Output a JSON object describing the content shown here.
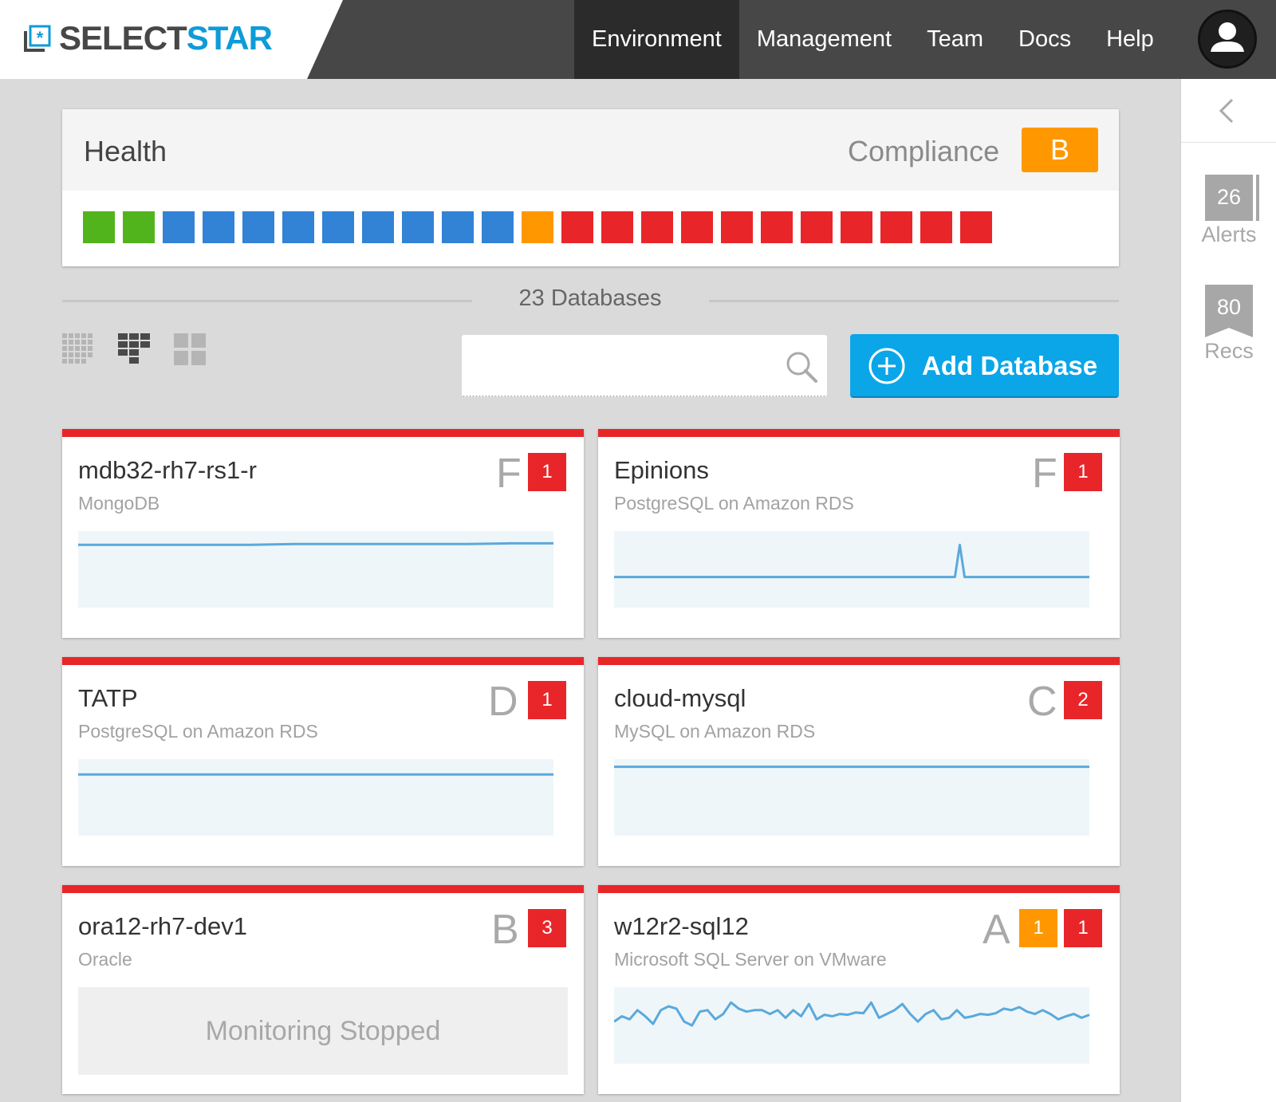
{
  "brand": {
    "word_1": "SELECT",
    "word_2": "STAR",
    "color_dark": "#474747",
    "color_accent": "#0e9bd8"
  },
  "nav": {
    "items": [
      {
        "label": "Environment",
        "active": true
      },
      {
        "label": "Management",
        "active": false
      },
      {
        "label": "Team",
        "active": false
      },
      {
        "label": "Docs",
        "active": false
      },
      {
        "label": "Help",
        "active": false
      }
    ],
    "user_icon": "user-avatar-icon"
  },
  "rail": {
    "collapse_icon": "chevron-left-icon",
    "alerts": {
      "count": "26",
      "label": "Alerts"
    },
    "recs": {
      "count": "80",
      "label": "Recs"
    }
  },
  "health": {
    "title": "Health",
    "compliance_label": "Compliance",
    "compliance_grade": "B",
    "squares": [
      "green",
      "green",
      "blue",
      "blue",
      "blue",
      "blue",
      "blue",
      "blue",
      "blue",
      "blue",
      "blue",
      "orange",
      "red",
      "red",
      "red",
      "red",
      "red",
      "red",
      "red",
      "red",
      "red",
      "red",
      "red"
    ],
    "colors": {
      "green": "#52b41d",
      "blue": "#3282d6",
      "orange": "#ff9800",
      "red": "#e8262a"
    }
  },
  "toolbar": {
    "db_count": "23 Databases",
    "search_placeholder": "",
    "add_database_label": "Add Database",
    "views": [
      "dense-grid-view-icon",
      "list-grid-view-icon",
      "tile-grid-view-icon"
    ]
  },
  "databases": [
    {
      "name": "mdb32-rh7-rs1-r",
      "type": "MongoDB",
      "grade": "F",
      "badges": [
        {
          "value": "1",
          "color": "red"
        }
      ],
      "spark": [
        0.18,
        0.18,
        0.18,
        0.18,
        0.18,
        0.17,
        0.17,
        0.17,
        0.17,
        0.17,
        0.16,
        0.16
      ],
      "stopped": false
    },
    {
      "name": "Epinions",
      "type": "PostgreSQL on Amazon RDS",
      "grade": "F",
      "badges": [
        {
          "value": "1",
          "color": "red"
        }
      ],
      "spark": [
        0.6,
        0.6,
        0.6,
        0.6,
        0.6,
        0.6,
        0.6,
        0.6,
        0.6,
        0.6,
        0.6,
        0.6,
        0.6,
        0.6,
        0.6,
        0.6,
        0.6,
        0.6,
        0.6,
        0.6,
        0.6,
        0.6,
        0.6,
        0.6,
        0.6,
        0.6,
        0.6,
        0.6,
        0.6,
        0.6,
        0.6,
        0.6,
        0.6,
        0.6,
        0.6,
        0.6,
        0.6,
        0.6,
        0.6,
        0.6,
        0.6,
        0.6,
        0.6,
        0.6,
        0.6,
        0.6,
        0.6,
        0.6,
        0.6,
        0.6,
        0.6,
        0.6,
        0.6,
        0.6,
        0.6,
        0.6,
        0.6,
        0.6,
        0.6,
        0.6,
        0.6,
        0.6,
        0.6,
        0.6,
        0.6,
        0.6,
        0.6,
        0.6,
        0.6,
        0.6,
        0.6,
        0.6,
        0.18,
        0.6,
        0.6,
        0.6,
        0.6,
        0.6,
        0.6,
        0.6,
        0.6,
        0.6,
        0.6,
        0.6,
        0.6,
        0.6,
        0.6,
        0.6,
        0.6,
        0.6,
        0.6,
        0.6,
        0.6,
        0.6,
        0.6,
        0.6,
        0.6,
        0.6,
        0.6,
        0.6
      ],
      "stopped": false
    },
    {
      "name": "TATP",
      "type": "PostgreSQL on Amazon RDS",
      "grade": "D",
      "badges": [
        {
          "value": "1",
          "color": "red"
        }
      ],
      "spark": [
        0.2,
        0.2,
        0.2,
        0.2,
        0.2,
        0.2
      ],
      "stopped": false
    },
    {
      "name": "cloud-mysql",
      "type": "MySQL on Amazon RDS",
      "grade": "C",
      "badges": [
        {
          "value": "2",
          "color": "red"
        }
      ],
      "spark": [
        0.1,
        0.1,
        0.1,
        0.1,
        0.1,
        0.1
      ],
      "stopped": false
    },
    {
      "name": "ora12-rh7-dev1",
      "type": "Oracle",
      "grade": "B",
      "badges": [
        {
          "value": "3",
          "color": "red"
        }
      ],
      "spark": [],
      "stopped": true,
      "stopped_text": "Monitoring Stopped"
    },
    {
      "name": "w12r2-sql12",
      "type": "Microsoft SQL Server on VMware",
      "grade": "A",
      "badges": [
        {
          "value": "1",
          "color": "orange"
        },
        {
          "value": "1",
          "color": "red"
        }
      ],
      "spark": [
        0.45,
        0.38,
        0.42,
        0.3,
        0.38,
        0.48,
        0.3,
        0.25,
        0.28,
        0.45,
        0.5,
        0.32,
        0.3,
        0.42,
        0.35,
        0.2,
        0.28,
        0.32,
        0.3,
        0.3,
        0.35,
        0.3,
        0.4,
        0.3,
        0.38,
        0.22,
        0.42,
        0.36,
        0.38,
        0.35,
        0.36,
        0.33,
        0.34,
        0.2,
        0.4,
        0.35,
        0.3,
        0.22,
        0.35,
        0.45,
        0.35,
        0.3,
        0.42,
        0.4,
        0.3,
        0.4,
        0.38,
        0.35,
        0.36,
        0.34,
        0.28,
        0.3,
        0.26,
        0.32,
        0.35,
        0.3,
        0.35,
        0.42,
        0.38,
        0.35,
        0.4,
        0.36
      ],
      "stopped": false
    }
  ]
}
